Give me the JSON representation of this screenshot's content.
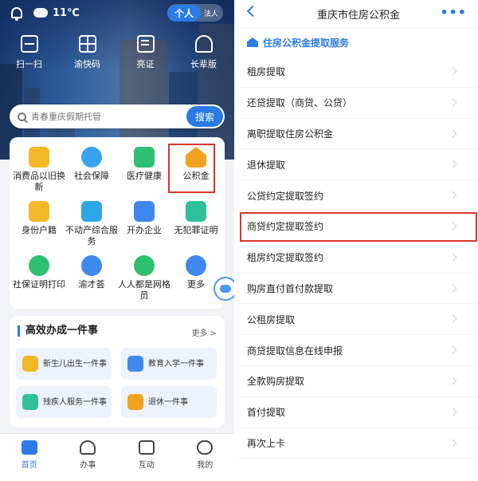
{
  "left": {
    "topbar": {
      "temperature": "11℃",
      "role_active": "个人",
      "role_other": "法人"
    },
    "quick_actions": [
      {
        "label": "扫一扫",
        "icon": "scan-icon"
      },
      {
        "label": "渝快码",
        "icon": "qr-code-icon"
      },
      {
        "label": "亮证",
        "icon": "id-card-icon"
      },
      {
        "label": "长辈版",
        "icon": "elder-icon"
      }
    ],
    "search": {
      "placeholder": "青春重庆假期托管",
      "button": "搜索"
    },
    "services": [
      {
        "label": "消费品以旧换新",
        "icon": "cart-icon",
        "color": "#f5b72a"
      },
      {
        "label": "社会保障",
        "icon": "heart-hand-icon",
        "color": "#36a3f0"
      },
      {
        "label": "医疗健康",
        "icon": "medical-icon",
        "color": "#2fbf71"
      },
      {
        "label": "公积金",
        "icon": "yuan-house-icon",
        "color": "#f0a21e"
      },
      {
        "label": "身份户籍",
        "icon": "id-book-icon",
        "color": "#f5b72a"
      },
      {
        "label": "不动产综合服务",
        "icon": "building-icon",
        "color": "#2fa6e8"
      },
      {
        "label": "开办企业",
        "icon": "company-icon",
        "color": "#3f88f0"
      },
      {
        "label": "无犯罪证明",
        "icon": "certificate-icon",
        "color": "#2fbf9a"
      },
      {
        "label": "社保证明打印",
        "icon": "shield-icon",
        "color": "#2fbf71"
      },
      {
        "label": "渝才荟",
        "icon": "talent-icon",
        "color": "#3f88f0"
      },
      {
        "label": "人人都是网格员",
        "icon": "grid-member-icon",
        "color": "#2fbf71"
      },
      {
        "label": "更多",
        "icon": "more-icon",
        "color": "#3f88f0"
      }
    ],
    "affairs": {
      "title": "高效办成一件事",
      "more": "更多 >",
      "items": [
        {
          "label": "新生儿出生一件事",
          "icon": "baby-icon",
          "color": "#f5b72a"
        },
        {
          "label": "教育入学一件事",
          "icon": "graduation-icon",
          "color": "#3f88f0"
        },
        {
          "label": "残疾人服务一件事",
          "icon": "disability-icon",
          "color": "#2fbf9a"
        },
        {
          "label": "退休一件事",
          "icon": "retire-icon",
          "color": "#f0a21e"
        }
      ]
    },
    "tabs": [
      {
        "label": "首页",
        "icon": "home-icon",
        "active": true
      },
      {
        "label": "办事",
        "icon": "heart-icon",
        "active": false
      },
      {
        "label": "互动",
        "icon": "calendar-icon",
        "active": false
      },
      {
        "label": "我的",
        "icon": "smile-icon",
        "active": false
      }
    ]
  },
  "right": {
    "nav": {
      "title": "重庆市住房公积金",
      "more": "•••"
    },
    "section": {
      "title": "住房公积金提取服务"
    },
    "items": [
      "租房提取",
      "还贷提取（商贷、公贷）",
      "离职提取住房公积金",
      "退休提取",
      "公贷约定提取签约",
      "商贷约定提取签约",
      "租房约定提取签约",
      "购房直付首付款提取",
      "公租房提取",
      "商贷提取信息在线申报",
      "全款购房提取",
      "首付提取",
      "再次上卡"
    ],
    "highlighted_item": "商贷约定提取签约"
  }
}
